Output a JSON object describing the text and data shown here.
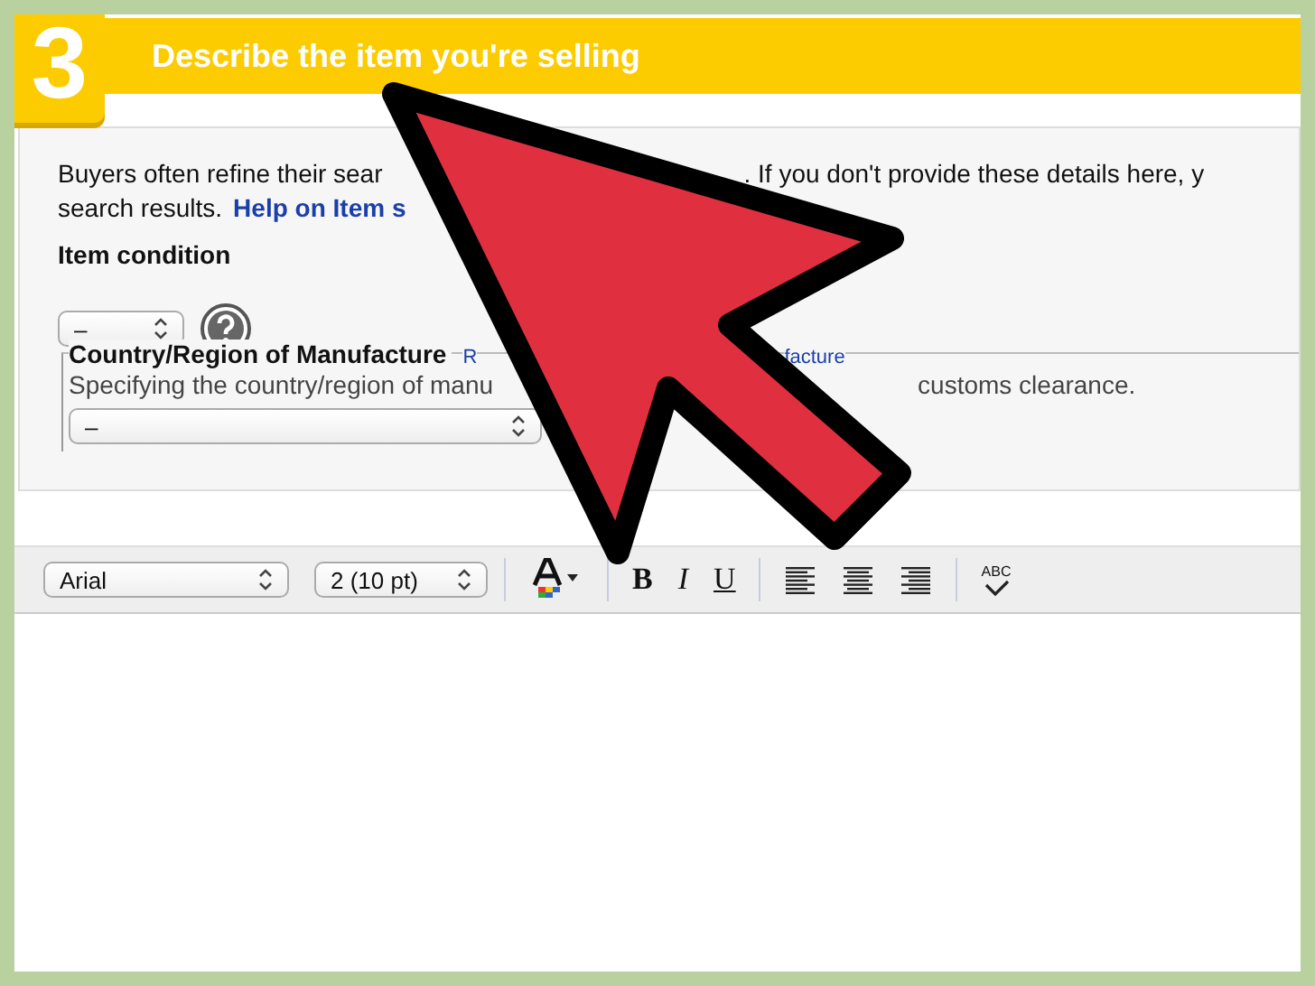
{
  "step": {
    "number": "3",
    "title": "Describe the item you're selling"
  },
  "intro": {
    "line_1_start": "Buyers often refine their sear",
    "line_1_end": ". If you don't provide these details here, y",
    "line_2_text": "search results.",
    "line_2_link": "Help on Item s"
  },
  "item_condition": {
    "label": "Item condition",
    "select_value": "–"
  },
  "country": {
    "legend": "Country/Region of Manufacture",
    "link_start": "R",
    "link_end": "facture",
    "description_start": "Specifying the country/region of manu",
    "description_end": "customs clearance.",
    "select_value": "–"
  },
  "toolbar": {
    "font": "Arial",
    "size": "2 (10 pt)",
    "buttons": [
      {
        "kind": "color"
      },
      {
        "kind": "bold",
        "label": "B"
      },
      {
        "kind": "italic",
        "label": "I"
      },
      {
        "kind": "underline",
        "label": "U"
      },
      {
        "kind": "align-left"
      },
      {
        "kind": "align-center"
      },
      {
        "kind": "align-right"
      },
      {
        "kind": "spellcheck",
        "label": "ABC"
      }
    ]
  }
}
